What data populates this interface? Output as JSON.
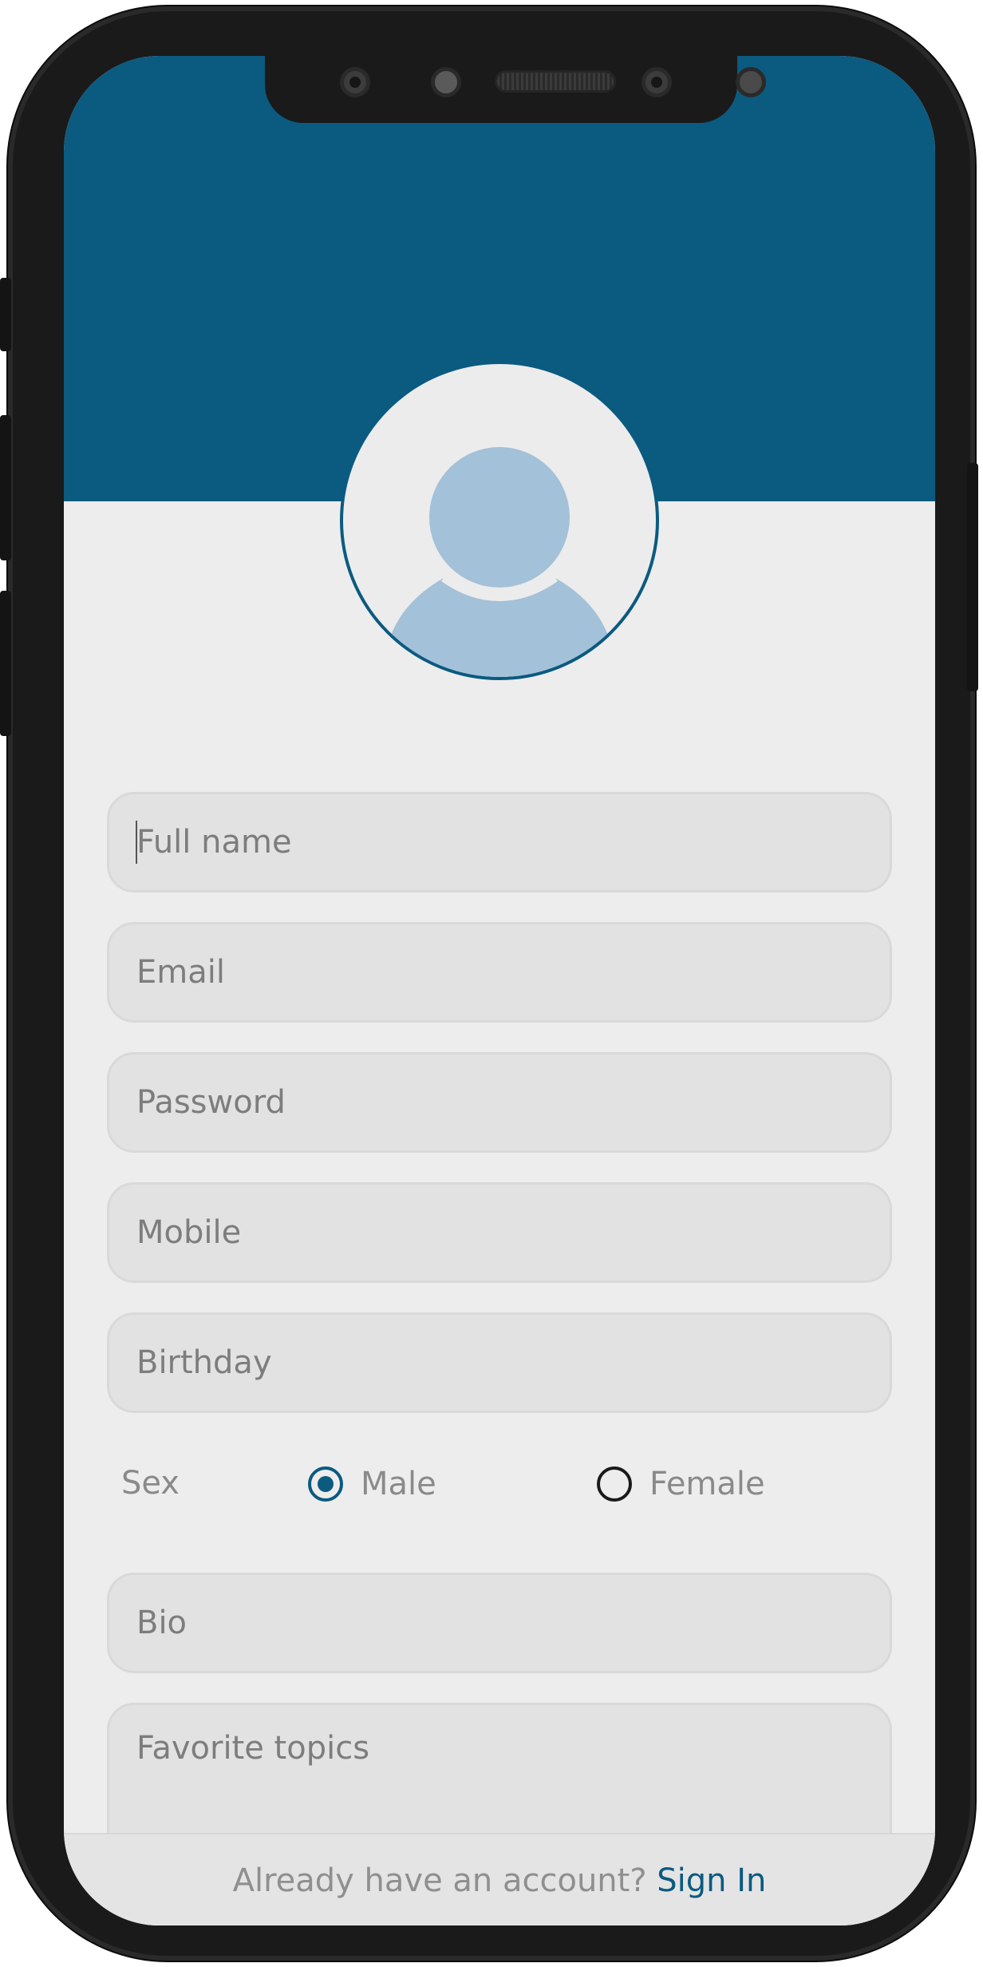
{
  "theme": {
    "accent": "#0b5a80",
    "avatar_fill": "#a3c1d8",
    "screen_bg": "#ededed",
    "field_bg": "#e2e2e2"
  },
  "avatar": {
    "icon": "user-silhouette-icon"
  },
  "form": {
    "full_name": {
      "placeholder": "Full name",
      "value": ""
    },
    "email": {
      "placeholder": "Email",
      "value": ""
    },
    "password": {
      "placeholder": "Password",
      "value": ""
    },
    "mobile": {
      "placeholder": "Mobile",
      "value": ""
    },
    "birthday": {
      "placeholder": "Birthday",
      "value": ""
    },
    "sex": {
      "label": "Sex",
      "options": [
        {
          "label": "Male",
          "selected": true
        },
        {
          "label": "Female",
          "selected": false
        }
      ]
    },
    "bio": {
      "placeholder": "Bio",
      "value": ""
    },
    "favorite_topics": {
      "placeholder": "Favorite topics",
      "value": ""
    }
  },
  "footer": {
    "prompt": "Already have an account?",
    "link_label": "Sign In"
  }
}
